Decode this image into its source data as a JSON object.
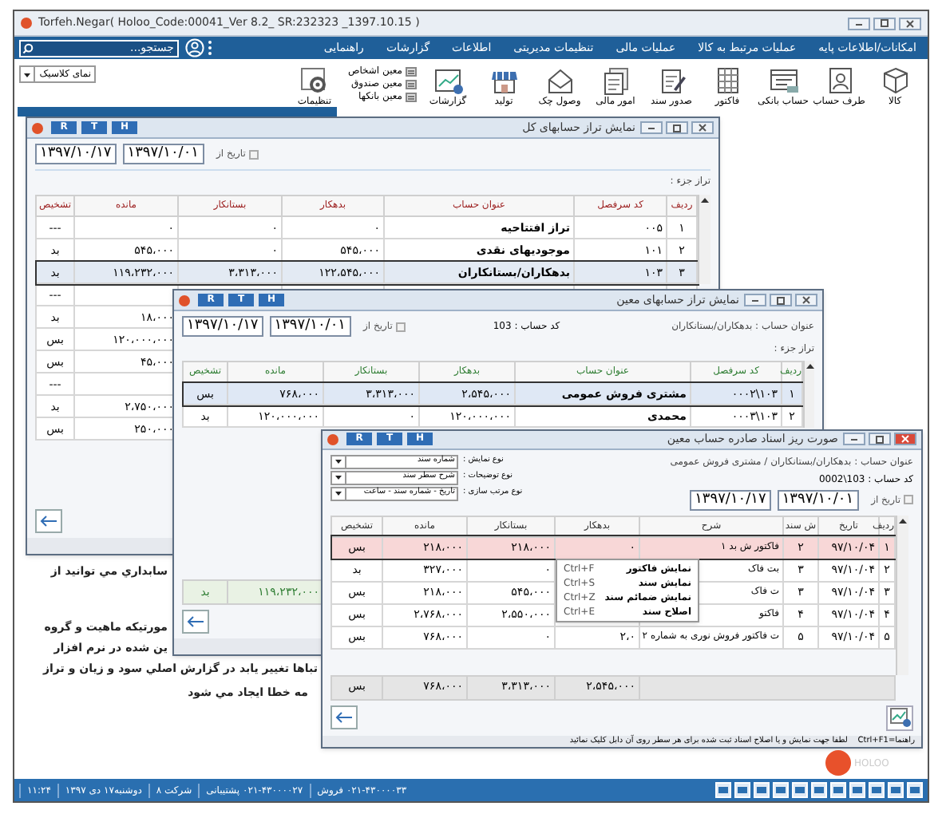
{
  "window": {
    "title": "Torfeh.Negar( Holoo_Code:00041_Ver 8.2_ SR:232323 _1397.10.15 )"
  },
  "menu": {
    "items": [
      "امکانات/اطلاعات پایه",
      "عملیات مرتبط به کالا",
      "عملیات مالی",
      "تنظیمات مدیریتی",
      "اطلاعات",
      "گزارشات",
      "راهنمایی"
    ],
    "search": {
      "placeholder": "جستجو..."
    }
  },
  "toolbar": {
    "buttons": [
      "کالا",
      "طرف حساب",
      "حساب بانکی",
      "فاکتور",
      "صدور سند",
      "امور مالی",
      "وصول چک",
      "تولید",
      "گزارشات"
    ],
    "ledgers": [
      "معین اشخاص",
      "معین صندوق",
      "معین بانکها"
    ],
    "settings": "تنظیمات",
    "view_select": {
      "value": "نمای کلاسیک"
    }
  },
  "background_text": [
    "سابداري مي توانيد از",
    "مورتيکه ماهيت و گروه",
    "ين شده در نرم افزار",
    "تباها تغيير يابد در گزارش اصلي سود و زيان و تراز",
    "مه خطا ايجاد مي شود"
  ],
  "general_ledger_window": {
    "title": "نمایش تراز حسابهای کل",
    "title_buttons": [
      "H",
      "T",
      "R"
    ],
    "date_filter": {
      "label": "تاریخ از",
      "checked": false,
      "from": "۱۳۹۷/۱۰/۰۱",
      "to": "۱۳۹۷/۱۰/۱۷"
    },
    "detail_label": "تراز جزء :",
    "columns": [
      "ردیف",
      "کد سرفصل",
      "عنوان حساب",
      "بدهکار",
      "بستانکار",
      "مانده",
      "تشخیص"
    ],
    "rows": [
      {
        "row_no": "۱",
        "code": "۰۰۵",
        "account": "تراز افتتاحیه",
        "debit": "۰",
        "credit": "۰",
        "balance": "۰",
        "diagnosis": "---",
        "selected": false
      },
      {
        "row_no": "۲",
        "code": "۱۰۱",
        "account": "موجودیهای نقدی",
        "debit": "۵۴۵،۰۰۰",
        "credit": "۰",
        "balance": "۵۴۵،۰۰۰",
        "diagnosis": "بد",
        "selected": false
      },
      {
        "row_no": "۳",
        "code": "۱۰۳",
        "account": "بدهکاران/بستانکاران",
        "debit": "۱۲۲،۵۴۵،۰۰۰",
        "credit": "۳،۳۱۳،۰۰۰",
        "balance": "۱۱۹،۲۳۲،۰۰۰",
        "diagnosis": "بد",
        "selected": true
      },
      {
        "diagnosis": "---",
        "selected": false
      },
      {
        "balance": "۱۸،۰۰۰",
        "diagnosis": "بد",
        "selected": false
      },
      {
        "balance": "۱۲۰،۰۰۰،۰۰۰",
        "diagnosis": "بس",
        "selected": false
      },
      {
        "balance": "۴۵،۰۰۰",
        "diagnosis": "بس",
        "selected": false
      },
      {
        "diagnosis": "---",
        "selected": false
      },
      {
        "balance": "۲،۷۵۰،۰۰۰",
        "diagnosis": "بد",
        "selected": false
      },
      {
        "balance": "۲۵۰،۰۰۰",
        "diagnosis": "بس",
        "selected": false
      }
    ]
  },
  "subsidiary_ledger_window": {
    "title": "نمایش تراز حسابهای معین",
    "title_buttons": [
      "H",
      "T",
      "R"
    ],
    "date_filter": {
      "label": "تاریخ از",
      "checked": false,
      "from": "۱۳۹۷/۱۰/۰۱",
      "to": "۱۳۹۷/۱۰/۱۷"
    },
    "account_code": "کد حساب : 103",
    "account_title": "عنوان حساب : بدهکاران/بستانکاران",
    "detail_label": "تراز جزء :",
    "columns": [
      "ردیف",
      "کد سرفصل",
      "عنوان حساب",
      "بدهکار",
      "بستانکار",
      "مانده",
      "تشخیص"
    ],
    "rows": [
      {
        "row_no": "۱",
        "code": "۱۰۳\\۰۰۰۲",
        "account": "مشتری فروش عمومی",
        "debit": "۲،۵۴۵،۰۰۰",
        "credit": "۳،۳۱۳،۰۰۰",
        "balance": "۷۶۸،۰۰۰",
        "diagnosis": "بس",
        "selected": true
      },
      {
        "row_no": "۲",
        "code": "۱۰۳\\۰۰۰۳",
        "account": "محمدی",
        "debit": "۱۲۰،۰۰۰،۰۰۰",
        "credit": "۰",
        "balance": "۱۲۰،۰۰۰،۰۰۰",
        "diagnosis": "بد",
        "selected": false
      }
    ],
    "totals": {
      "balance": "۱۱۹،۲۳۲،۰۰۰",
      "diagnosis": "بد"
    }
  },
  "documents_window": {
    "title": "صورت ریز اسناد صادره حساب معین",
    "title_buttons": [
      "H",
      "T",
      "R"
    ],
    "account_title": "عنوان حساب : بدهکاران/بستانکاران / مشتری فروش عمومی",
    "account_code": "کد حساب :  103\\0002",
    "date_filter": {
      "label": "تاریخ از",
      "checked": false,
      "from": "۱۳۹۷/۱۰/۰۱",
      "to": "۱۳۹۷/۱۰/۱۷"
    },
    "options": [
      {
        "label": "نوع نمایش :",
        "value": "شماره سند"
      },
      {
        "label": "نوع توضیحات :",
        "value": "شرح سطر سند"
      },
      {
        "label": "نوع مرتب سازی :",
        "value": "تاریخ - شماره سند - ساعت"
      }
    ],
    "columns": [
      "ردیف",
      "تاریخ",
      "ش سند",
      "شرح",
      "بدهکار",
      "بستانکار",
      "مانده",
      "تشخیص"
    ],
    "rows": [
      {
        "row_no": "۱",
        "date": "۹۷/۱۰/۰۴",
        "doc_no": "۲",
        "description": "فاکتور ش بد ۱",
        "debit": "۰",
        "credit": "۲۱۸،۰۰۰",
        "balance": "۲۱۸،۰۰۰",
        "diagnosis": "بس",
        "selected": true
      },
      {
        "row_no": "۲",
        "date": "۹۷/۱۰/۰۴",
        "doc_no": "۳",
        "description": "بت فاک",
        "credit": "۰",
        "balance": "۳۲۷،۰۰۰",
        "diagnosis": "بد",
        "selected": false
      },
      {
        "row_no": "۳",
        "date": "۹۷/۱۰/۰۴",
        "doc_no": "۳",
        "description": "ت فاک",
        "credit": "۵۴۵،۰۰۰",
        "balance": "۲۱۸،۰۰۰",
        "diagnosis": "بس",
        "selected": false
      },
      {
        "row_no": "۴",
        "date": "۹۷/۱۰/۰۴",
        "doc_no": "۴",
        "description": "فاکتو",
        "credit": "۲،۵۵۰،۰۰۰",
        "balance": "۲،۷۶۸،۰۰۰",
        "diagnosis": "بس",
        "selected": false
      },
      {
        "row_no": "۵",
        "date": "۹۷/۱۰/۰۴",
        "doc_no": "۵",
        "description": "ت فاکتور فروش نوری به شماره ۲",
        "debit": "۲،۰",
        "credit": "۰",
        "balance": "۷۶۸،۰۰۰",
        "diagnosis": "بس",
        "selected": false
      }
    ],
    "totals": {
      "debit": "۲،۵۴۵،۰۰۰",
      "credit": "۳،۳۱۳،۰۰۰",
      "balance": "۷۶۸،۰۰۰",
      "diagnosis": "بس"
    },
    "hint": "راهنما=Ctrl+F1    لطفا جهت نمایش و یا اصلاح اسناد ثبت شده برای هر سطر روی آن دابل کلیک نمائید"
  },
  "context_menu": {
    "items": [
      {
        "label": "نمایش فاکتور",
        "shortcut": "Ctrl+F"
      },
      {
        "label": "نمایش سند",
        "shortcut": "Ctrl+S"
      },
      {
        "label": "نمایش ضمائم سند",
        "shortcut": "Ctrl+Z"
      },
      {
        "label": "اصلاح سند",
        "shortcut": "Ctrl+E"
      }
    ]
  },
  "brand": "HOLOO",
  "status_bar": {
    "items": [
      "۰۲۱-۴۳۰۰۰۰۳۳ فروش",
      "۰۲۱-۴۳۰۰۰۰۲۷ پشتیبانی",
      "شرکت ۸",
      "دوشنبه۱۷ دی ۱۳۹۷",
      "۱۱:۲۴"
    ]
  }
}
